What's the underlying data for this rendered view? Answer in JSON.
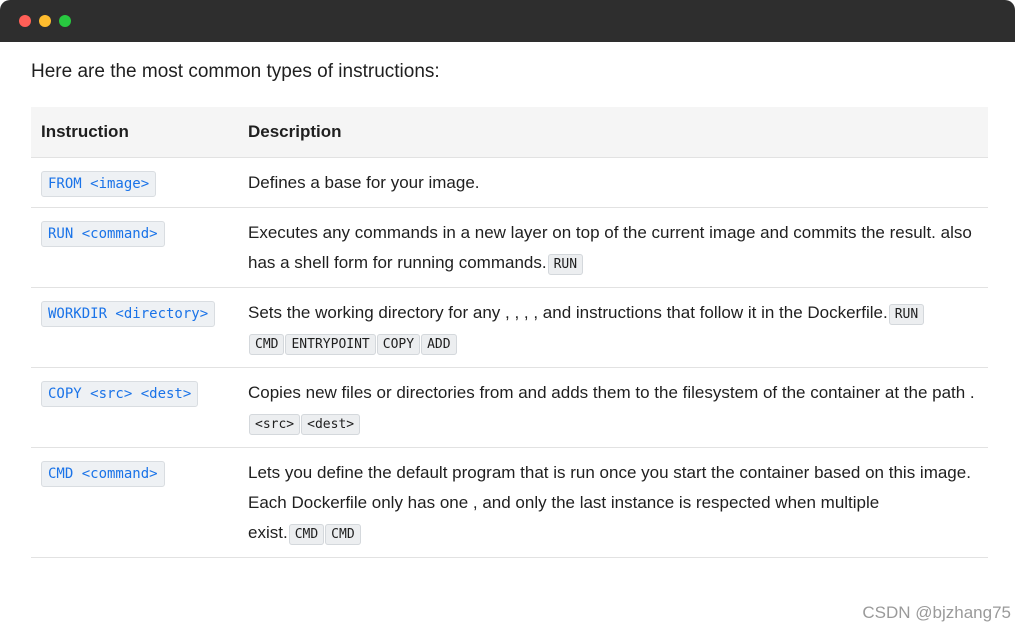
{
  "intro": "Here are the most common types of instructions:",
  "table": {
    "headers": [
      "Instruction",
      "Description"
    ],
    "rows": [
      {
        "instruction": "FROM <image>",
        "description": "Defines a base for your image.",
        "tags": []
      },
      {
        "instruction": "RUN <command>",
        "description": "Executes any commands in a new layer on top of the current image and commits the result. also has a shell form for running commands.",
        "tags": [
          "RUN"
        ]
      },
      {
        "instruction": "WORKDIR <directory>",
        "description": "Sets the working directory for any , , , , and instructions that follow it in the Dockerfile.",
        "tags": [
          "RUN",
          "CMD",
          "ENTRYPOINT",
          "COPY",
          "ADD"
        ]
      },
      {
        "instruction": "COPY <src> <dest>",
        "description": "Copies new files or directories from and adds them to the filesystem of the container at the path .",
        "tags": [
          "<src>",
          "<dest>"
        ]
      },
      {
        "instruction": "CMD <command>",
        "description": "Lets you define the default program that is run once you start the container based on this image. Each Dockerfile only has one , and only the last instance is respected when multiple exist.",
        "tags": [
          "CMD",
          "CMD"
        ]
      }
    ]
  },
  "watermark": "CSDN @bjzhang75",
  "colors": {
    "titlebar": "#2e2e2e",
    "code_blue": "#1a73e8",
    "header_bg": "#f5f5f5"
  }
}
